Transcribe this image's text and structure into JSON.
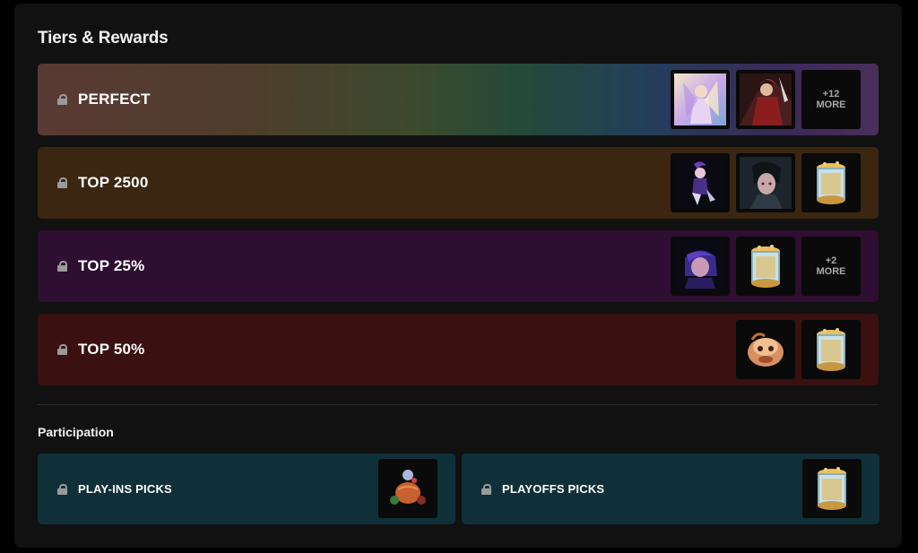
{
  "title": "Tiers & Rewards",
  "tiers": [
    {
      "name": "PERFECT",
      "rewards": [
        "splash-art-lux-icon",
        "splash-art-redknight-icon"
      ],
      "more": [
        "+12",
        "MORE"
      ]
    },
    {
      "name": "TOP 2500",
      "rewards": [
        "chibi-mage-icon",
        "splash-art-darkhero-icon",
        "capsule-icon"
      ]
    },
    {
      "name": "TOP 25%",
      "rewards": [
        "portrait-champion-icon",
        "capsule-icon"
      ],
      "more": [
        "+2",
        "MORE"
      ]
    },
    {
      "name": "TOP 50%",
      "rewards": [
        "emote-poro-icon",
        "capsule-icon"
      ]
    }
  ],
  "participation": {
    "title": "Participation",
    "items": [
      {
        "name": "PLAY-INS PICKS",
        "reward": "summoner-icon-pumpkin"
      },
      {
        "name": "PLAYOFFS PICKS",
        "reward": "capsule-icon"
      }
    ]
  },
  "colors": {
    "panel": "#111111",
    "top2500": "#3b2611",
    "top25": "#2e0e31",
    "top50": "#3a1010",
    "participation": "#0f3038"
  }
}
